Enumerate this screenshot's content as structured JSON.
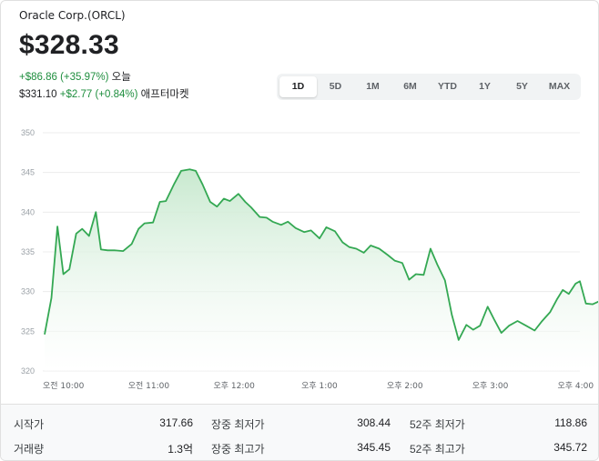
{
  "header": {
    "company": "Oracle Corp.(ORCL)",
    "price": "$328.33",
    "change_today": "+$86.86 (+35.97%)",
    "change_today_label": "오늘",
    "after_hours_price": "$331.10",
    "after_hours_change": "+$2.77 (+0.84%)",
    "after_hours_label": "애프터마켓"
  },
  "range_tabs": [
    {
      "label": "1D",
      "active": true
    },
    {
      "label": "5D",
      "active": false
    },
    {
      "label": "1M",
      "active": false
    },
    {
      "label": "6M",
      "active": false
    },
    {
      "label": "YTD",
      "active": false
    },
    {
      "label": "1Y",
      "active": false
    },
    {
      "label": "5Y",
      "active": false
    },
    {
      "label": "MAX",
      "active": false
    }
  ],
  "stats": {
    "open_label": "시작가",
    "open_value": "317.66",
    "volume_label": "거래량",
    "volume_value": "1.3억",
    "day_low_label": "장중 최저가",
    "day_low_value": "308.44",
    "day_high_label": "장중 최고가",
    "day_high_value": "345.45",
    "wk52_low_label": "52주 최저가",
    "wk52_low_value": "118.86",
    "wk52_high_label": "52주 최고가",
    "wk52_high_value": "345.72"
  },
  "colors": {
    "line": "#34a853",
    "fill_top": "#c8e9cf",
    "grid": "#ececec",
    "positive": "#1e8e3e"
  },
  "chart_data": {
    "type": "area",
    "x_tick_labels": [
      "오전 10:00",
      "오전 11:00",
      "오후 12:00",
      "오후 1:00",
      "오후 2:00",
      "오후 3:00",
      "오후 4:00"
    ],
    "x_tick_hours": [
      10,
      11,
      12,
      13,
      14,
      15,
      16
    ],
    "y_ticks": [
      320,
      325,
      330,
      335,
      340,
      345,
      350
    ],
    "ylim": [
      320,
      350
    ],
    "xlim": [
      9.78,
      16.05
    ],
    "grid": true,
    "series": [
      {
        "x": [
          9.78,
          9.86,
          9.93,
          10.0,
          10.07,
          10.15,
          10.22,
          10.3,
          10.38,
          10.44,
          10.52,
          10.6,
          10.7,
          10.8,
          10.88,
          10.95,
          11.05,
          11.13,
          11.2,
          11.3,
          11.38,
          11.48,
          11.55,
          11.63,
          11.72,
          11.8,
          11.88,
          11.95,
          12.05,
          12.13,
          12.2,
          12.3,
          12.38,
          12.45,
          12.55,
          12.63,
          12.72,
          12.82,
          12.9,
          13.0,
          13.08,
          13.18,
          13.27,
          13.35,
          13.43,
          13.52,
          13.6,
          13.7,
          13.8,
          13.88,
          13.97,
          14.05,
          14.13,
          14.22,
          14.3,
          14.38,
          14.47,
          14.55,
          14.63,
          14.72,
          14.8,
          14.88,
          14.97,
          15.05,
          15.13,
          15.22,
          15.32,
          15.42,
          15.52,
          15.6,
          15.7,
          15.78,
          15.85,
          15.92,
          16.0,
          16.05
        ],
        "y": [
          324.6,
          329.2,
          338.2,
          332.2,
          332.8,
          337.3,
          337.9,
          337.0,
          340.0,
          335.3,
          335.2,
          335.2,
          335.1,
          336.0,
          337.9,
          338.6,
          338.7,
          341.3,
          341.4,
          343.6,
          345.2,
          345.4,
          345.2,
          343.5,
          341.3,
          340.7,
          341.7,
          341.4,
          342.3,
          341.3,
          340.6,
          339.4,
          339.3,
          338.8,
          338.4,
          338.8,
          338.0,
          337.5,
          337.7,
          336.7,
          338.1,
          337.6,
          336.2,
          335.6,
          335.4,
          334.9,
          335.8,
          335.4,
          334.6,
          333.9,
          333.6,
          331.5,
          332.2,
          332.1,
          335.4,
          333.4,
          331.4,
          327.1,
          323.9,
          325.8,
          325.2,
          325.7,
          328.1,
          326.4,
          324.8,
          325.7,
          326.3,
          325.7,
          325.1,
          326.2,
          327.4,
          329.0,
          330.2,
          329.7,
          331.0,
          331.3
        ]
      }
    ],
    "tail": {
      "x": [
        16.05,
        16.12,
        16.2,
        16.28
      ],
      "y": [
        331.3,
        328.5,
        328.4,
        328.8
      ]
    }
  }
}
